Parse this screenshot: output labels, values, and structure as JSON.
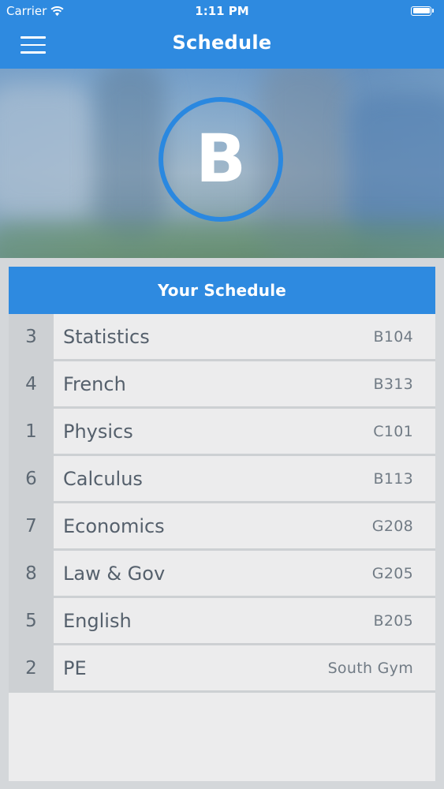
{
  "status": {
    "carrier": "Carrier",
    "time": "1:11 PM"
  },
  "nav": {
    "title": "Schedule"
  },
  "logo": {
    "letter": "B"
  },
  "schedule": {
    "header": "Your Schedule",
    "rows": [
      {
        "period": "3",
        "name": "Statistics",
        "room": "B104"
      },
      {
        "period": "4",
        "name": "French",
        "room": "B313"
      },
      {
        "period": "1",
        "name": "Physics",
        "room": "C101"
      },
      {
        "period": "6",
        "name": "Calculus",
        "room": "B113"
      },
      {
        "period": "7",
        "name": "Economics",
        "room": "G208"
      },
      {
        "period": "8",
        "name": "Law & Gov",
        "room": "G205"
      },
      {
        "period": "5",
        "name": "English",
        "room": "B205"
      },
      {
        "period": "2",
        "name": "PE",
        "room": "South Gym"
      }
    ]
  },
  "colors": {
    "accent": "#2e8ae0",
    "period_bg": "#cdd0d3",
    "row_bg": "#ececed"
  }
}
